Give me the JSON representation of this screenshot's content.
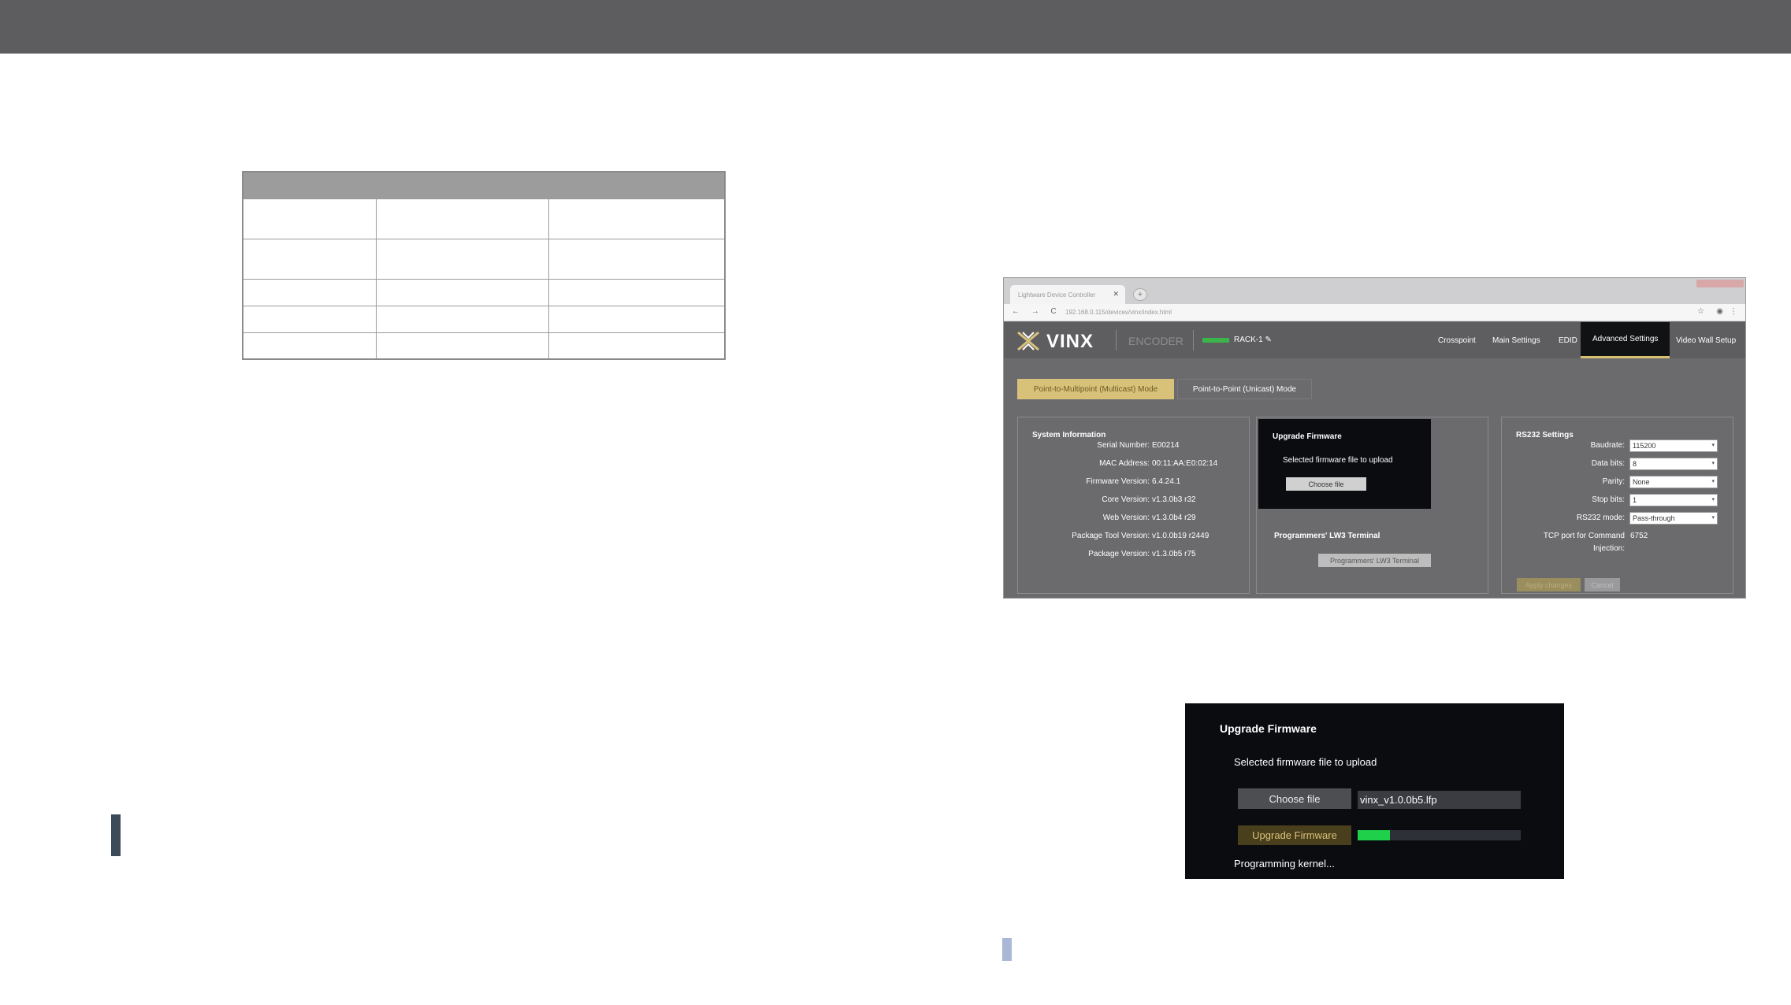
{
  "browser": {
    "tab_title": "Lightware Device Controller",
    "url": "192.168.0.115/devices/vinx/index.html",
    "nav_icons": "← → C"
  },
  "app": {
    "logo_text": "VINX",
    "mode_label": "ENCODER",
    "device_name": "RACK-1 ✎",
    "menu": [
      "Crosspoint",
      "Main Settings",
      "EDID",
      "Advanced Settings",
      "Video Wall Setup"
    ],
    "active_menu": "Advanced Settings",
    "mode_tabs": {
      "multicast": "Point-to-Multipoint (Multicast) Mode",
      "unicast": "Point-to-Point (Unicast) Mode"
    },
    "system_info": {
      "title": "System Information",
      "rows": [
        {
          "k": "Serial Number:",
          "v": "E00214"
        },
        {
          "k": "MAC Address:",
          "v": "00:11:AA:E0:02:14"
        },
        {
          "k": "Firmware Version:",
          "v": "6.4.24.1"
        },
        {
          "k": "Core Version:",
          "v": "v1.3.0b3 r32"
        },
        {
          "k": "Web Version:",
          "v": "v1.3.0b4 r29"
        },
        {
          "k": "Package Tool Version:",
          "v": "v1.0.0b19 r2449"
        },
        {
          "k": "Package Version:",
          "v": "v1.3.0b5 r75"
        }
      ]
    },
    "upgrade": {
      "title": "Upgrade Firmware",
      "subtitle": "Selected firmware file to upload",
      "choose_label": "Choose file",
      "terminal_title": "Programmers' LW3 Terminal",
      "terminal_button": "Programmers' LW3 Terminal"
    },
    "rs232": {
      "title": "RS232 Settings",
      "baudrate_label": "Baudrate:",
      "baudrate": "115200",
      "databits_label": "Data bits:",
      "databits": "8",
      "parity_label": "Parity:",
      "parity": "None",
      "stopbits_label": "Stop bits:",
      "stopbits": "1",
      "mode_label": "RS232 mode:",
      "mode": "Pass-through",
      "tcp_label_1": "TCP port for Command",
      "tcp_label_2": "Injection:",
      "tcp_port": "6752",
      "apply_label": "Apply changes",
      "cancel_label": "Cancel"
    }
  },
  "zoom": {
    "title": "Upgrade Firmware",
    "subtitle": "Selected firmware file to upload",
    "choose_label": "Choose file",
    "file_name": "vinx_v1.0.0b5.lfp",
    "upgrade_label": "Upgrade Firmware",
    "progress": 0.2,
    "status": "Programming kernel..."
  },
  "colors": {
    "topbar": "#5d5d5f",
    "accent": "#d8c27a",
    "progress": "#1fd14a",
    "status_led": "#3bb54a"
  }
}
